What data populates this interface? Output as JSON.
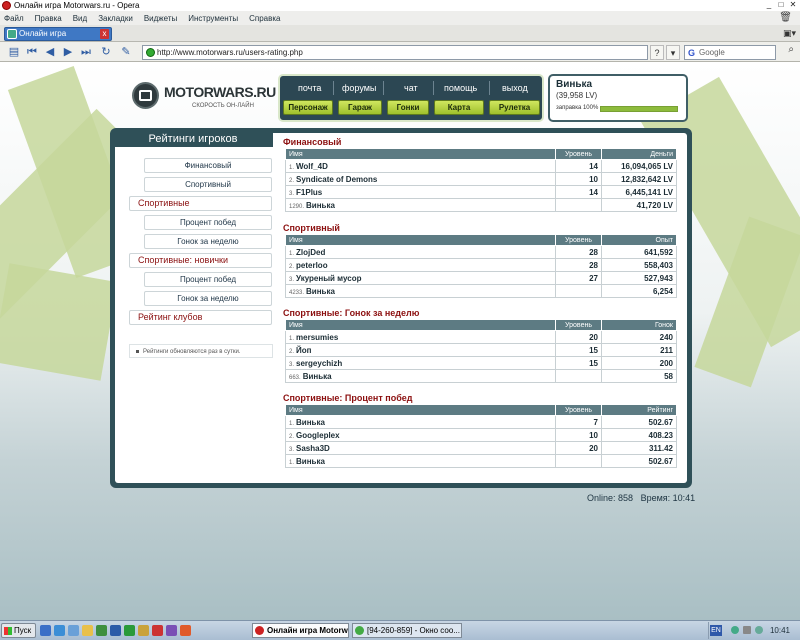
{
  "window": {
    "title": "Онлайн игра Motorwars.ru - Opera"
  },
  "menu": [
    "Файл",
    "Правка",
    "Вид",
    "Закладки",
    "Виджеты",
    "Инструменты",
    "Справка"
  ],
  "tab": {
    "label": "Онлайн игра Motorwars.ru"
  },
  "address": {
    "url": "http://www.motorwars.ru/users-rating.php"
  },
  "search": {
    "placeholder": "Google"
  },
  "site": {
    "logo": "MOTORWARS.RU",
    "tagline": "СКОРОСТЬ ОН-ЛАЙН",
    "top_links": [
      "почта",
      "форумы",
      "чат",
      "помощь",
      "выход"
    ],
    "buttons": [
      "Персонаж",
      "Гараж",
      "Гонки",
      "Карта",
      "Рулетка"
    ],
    "user": {
      "name": "Винька",
      "money": "(39,958 LV)",
      "fuel_label": "заправка 100%",
      "fuel_level": 1.0
    }
  },
  "sidebar": {
    "title": "Рейтинги игроков",
    "items": [
      {
        "label": "Финансовый",
        "kind": "sub"
      },
      {
        "label": "Спортивный",
        "kind": "sub"
      },
      {
        "label": "Спортивные",
        "kind": "cat"
      },
      {
        "label": "Процент побед",
        "kind": "sub"
      },
      {
        "label": "Гонок за неделю",
        "kind": "sub"
      },
      {
        "label": "Спортивные: новички",
        "kind": "cat"
      },
      {
        "label": "Процент побед",
        "kind": "sub"
      },
      {
        "label": "Гонок за неделю",
        "kind": "sub"
      },
      {
        "label": "Рейтинг клубов",
        "kind": "cat"
      }
    ],
    "note": "Рейтинги обновляются раз в сутки."
  },
  "ratings": [
    {
      "title": "Финансовый",
      "columns": [
        "Имя",
        "Уровень",
        "Деньги"
      ],
      "rows": [
        [
          "1.",
          "Wolf_4D",
          "14",
          "16,094,065 LV"
        ],
        [
          "2.",
          "Syndicate of Demons",
          "10",
          "12,832,642 LV"
        ],
        [
          "3.",
          "F1Plus",
          "14",
          "6,445,141 LV"
        ],
        [
          "1290.",
          "Винька",
          "",
          "41,720 LV"
        ]
      ]
    },
    {
      "title": "Спортивный",
      "columns": [
        "Имя",
        "Уровень",
        "Опыт"
      ],
      "rows": [
        [
          "1.",
          "ZlojDed",
          "28",
          "641,592"
        ],
        [
          "2.",
          "peterloo",
          "28",
          "558,403"
        ],
        [
          "3.",
          "Укуреный мусор",
          "27",
          "527,943"
        ],
        [
          "4233.",
          "Винька",
          "",
          "6,254"
        ]
      ]
    },
    {
      "title": "Спортивные: Гонок за неделю",
      "columns": [
        "Имя",
        "Уровень",
        "Гонок"
      ],
      "rows": [
        [
          "1.",
          "mersumies",
          "20",
          "240"
        ],
        [
          "2.",
          "Йоп",
          "15",
          "211"
        ],
        [
          "3.",
          "sergeychizh",
          "15",
          "200"
        ],
        [
          "663.",
          "Винька",
          "",
          "58"
        ]
      ]
    },
    {
      "title": "Спортивные: Процент побед",
      "columns": [
        "Имя",
        "Уровень",
        "Рейтинг"
      ],
      "rows": [
        [
          "1.",
          "Винька",
          "7",
          "502.67"
        ],
        [
          "2.",
          "Googleplex",
          "10",
          "408.23"
        ],
        [
          "3.",
          "Sasha3D",
          "20",
          "311.42"
        ],
        [
          "1.",
          "Винька",
          "",
          "502.67"
        ]
      ]
    }
  ],
  "footer": {
    "online": "Online: 858",
    "time": "Время: 10:41"
  },
  "taskbar": {
    "start": "Пуск",
    "tasks": [
      "Онлайн игра Motorw...",
      "[94-260-859] - Окно соо..."
    ],
    "lang": "EN",
    "clock": "10:41"
  }
}
